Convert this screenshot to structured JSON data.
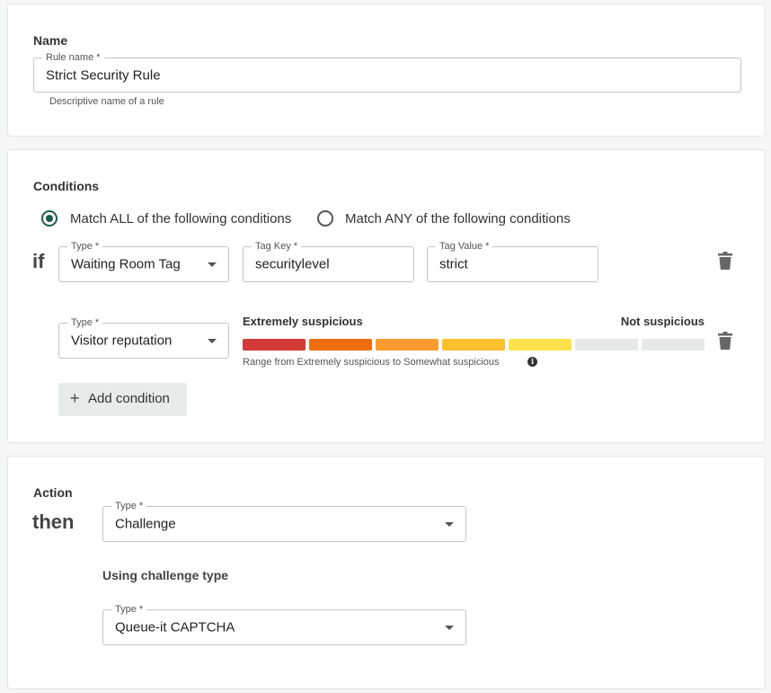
{
  "name_section": {
    "title": "Name",
    "rule_name": {
      "label": "Rule name *",
      "value": "Strict Security Rule",
      "helper": "Descriptive name of a rule"
    }
  },
  "conditions_section": {
    "title": "Conditions",
    "match_all_label": "Match ALL of the following conditions",
    "match_any_label": "Match ANY of the following conditions",
    "selected_match": "all",
    "if_word": "if",
    "condition1": {
      "type_label": "Type *",
      "type_value": "Waiting Room Tag",
      "tag_key_label": "Tag Key *",
      "tag_key_value": "securitylevel",
      "tag_value_label": "Tag Value *",
      "tag_value_value": "strict"
    },
    "condition2": {
      "type_label": "Type *",
      "type_value": "Visitor reputation",
      "left_label": "Extremely suspicious",
      "right_label": "Not suspicious",
      "range_text": "Range from Extremely suspicious to Somewhat suspicious",
      "segments": [
        "#d13a36",
        "#ee6e0e",
        "#fb9a2e",
        "#fdc12e",
        "#fbe24a",
        "#e5e9e9",
        "#e5e9e9"
      ]
    },
    "add_condition_label": "Add condition"
  },
  "action_section": {
    "title": "Action",
    "then_word": "then",
    "type_label": "Type *",
    "type_value": "Challenge",
    "challenge_subhead": "Using challenge type",
    "challenge_type_label": "Type *",
    "challenge_type_value": "Queue-it CAPTCHA"
  },
  "icons": {
    "delete": "trash-icon",
    "dropdown": "chevron-down-icon",
    "info": "info-icon",
    "add": "plus-icon"
  },
  "colors": {
    "accent": "#1f5a4a"
  }
}
